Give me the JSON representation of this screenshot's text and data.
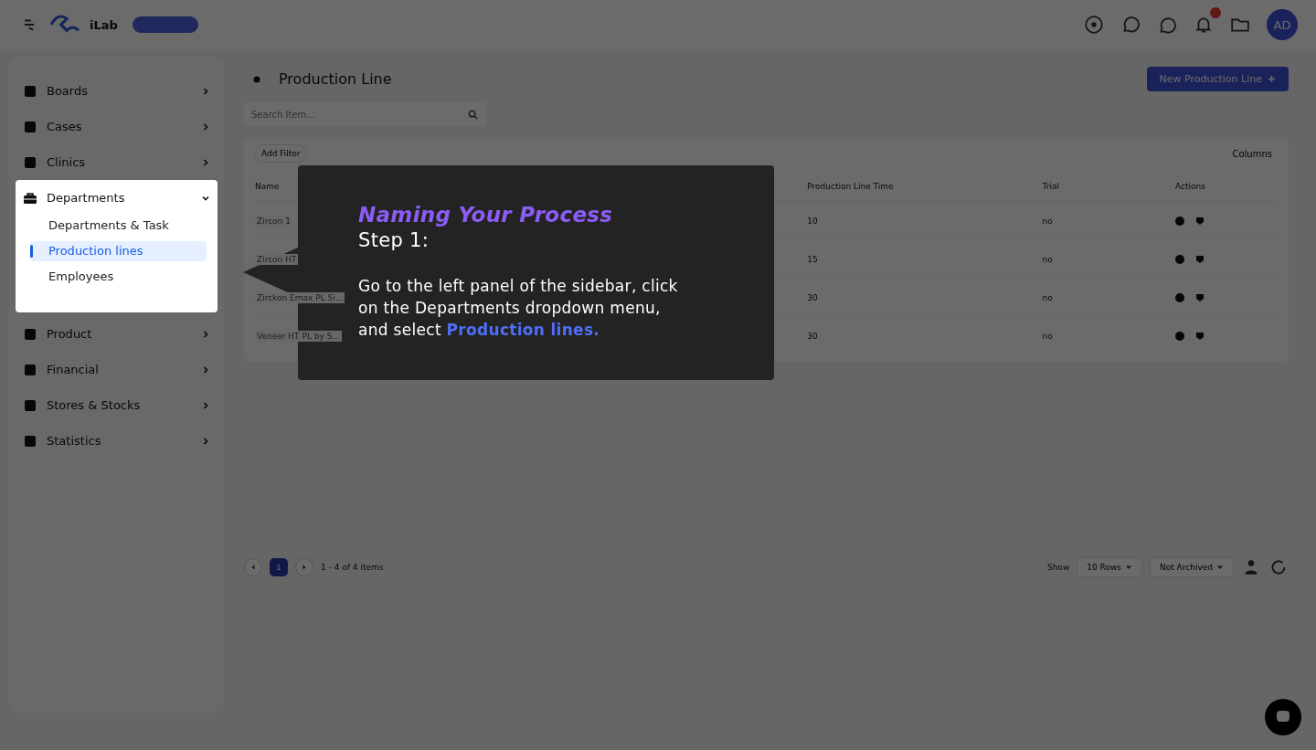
{
  "header": {
    "brand": "iLab",
    "avatar": "AD",
    "notification_dot": true
  },
  "sidebar": {
    "items": [
      {
        "label": "Boards",
        "expanded": false
      },
      {
        "label": "Cases",
        "expanded": false
      },
      {
        "label": "Clinics",
        "expanded": false
      },
      {
        "label": "Departments",
        "expanded": true,
        "children": [
          {
            "label": "Departments & Task",
            "selected": false
          },
          {
            "label": "Production lines",
            "selected": true
          },
          {
            "label": "Employees",
            "selected": false
          }
        ]
      },
      {
        "label": "Product",
        "expanded": false
      },
      {
        "label": "Financial",
        "expanded": false
      },
      {
        "label": "Stores & Stocks",
        "expanded": false
      },
      {
        "label": "Statistics",
        "expanded": false
      }
    ]
  },
  "page": {
    "title": "Production Line",
    "new_button": "New Production Line",
    "search": {
      "placeholder": "Search Item..."
    },
    "add_filter": "Add Filter",
    "columns_button": "Columns"
  },
  "table": {
    "columns": [
      "Name",
      "Production Line Time",
      "Trial",
      "Actions"
    ],
    "rows": [
      {
        "name": "Zircon 1",
        "time": "10",
        "trial": "no"
      },
      {
        "name": "Zircon HT",
        "time": "15",
        "trial": "no"
      },
      {
        "name": "Zirckon Emax PL Si...",
        "time": "30",
        "trial": "no"
      },
      {
        "name": "Veneer HT PL by S...",
        "time": "30",
        "trial": "no"
      }
    ]
  },
  "pagination": {
    "pages": [
      {
        "label": "1",
        "selected": true
      }
    ],
    "range": "1 - 4 of 4 items",
    "show_label": "Show",
    "rows_select": "10 Rows",
    "archive_select": "Not Archived"
  },
  "tour": {
    "title": "Naming Your Process",
    "step": "Step 1:",
    "text": "Go to the left panel of the sidebar, click\non the Departments dropdown menu,\nand select  **Production lines.**"
  }
}
